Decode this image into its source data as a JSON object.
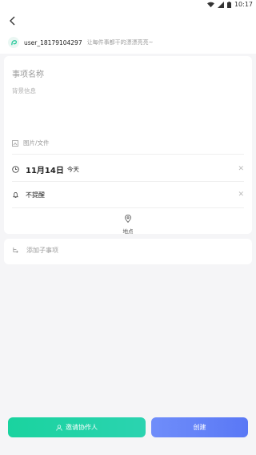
{
  "status_bar": {
    "time": "10:17"
  },
  "creator": {
    "username": "user_18179104297",
    "hint": "让每件事都干的漂漂亮亮~"
  },
  "task": {
    "title_placeholder": "事项名称",
    "background_placeholder": "背景信息",
    "attachment_label": "图片/文件",
    "date_main": "11月14日",
    "date_sub": "今天",
    "reminder": "不提醒",
    "location_label": "地点",
    "subtask_label": "添加子事项"
  },
  "actions": {
    "invite_label": "邀请协作人",
    "create_label": "创建"
  },
  "colors": {
    "invite_button": "#1ad39f",
    "create_button": "#6f8dfa"
  }
}
